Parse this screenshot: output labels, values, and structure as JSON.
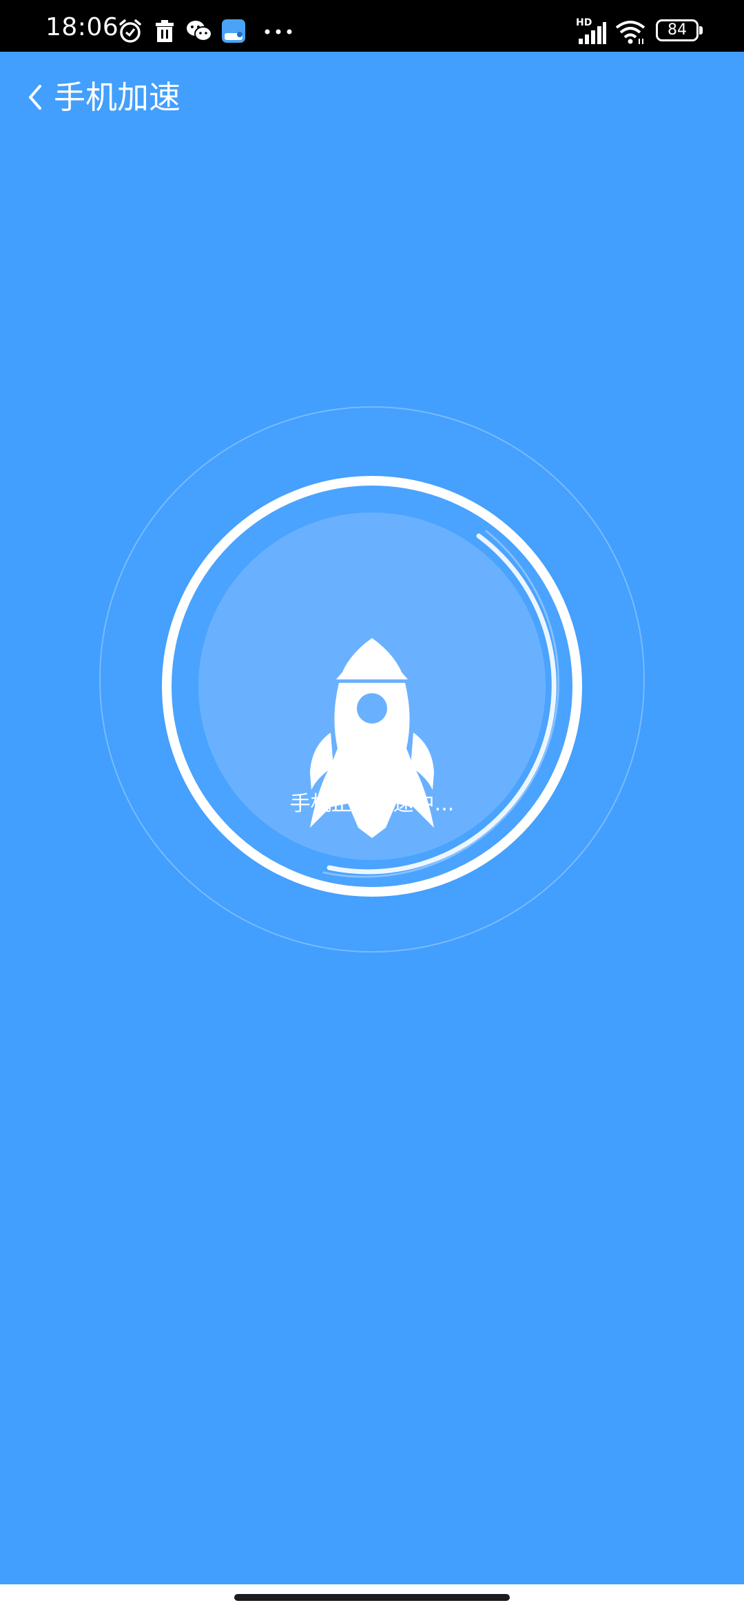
{
  "status_bar": {
    "time": "18:06",
    "network_label": "HD",
    "battery_level": "84",
    "icons": [
      "alarm-icon",
      "trash-icon",
      "wechat-icon",
      "app-notification-icon",
      "more-dots-icon",
      "signal-icon",
      "wifi-icon",
      "battery-icon"
    ]
  },
  "header": {
    "title": "手机加速",
    "back_icon": "chevron-left-icon"
  },
  "accelerator": {
    "status_text": "手机正在加速中...",
    "icon": "rocket-icon"
  },
  "colors": {
    "background": "#429ffe",
    "inner_disc": "#69b1fe",
    "ring": "#ffffff",
    "status_bar": "#000000"
  }
}
